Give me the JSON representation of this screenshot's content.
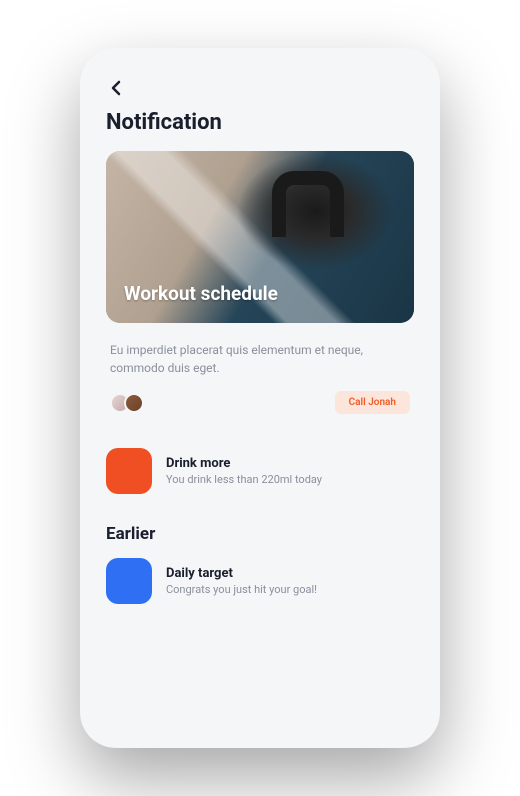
{
  "page": {
    "title": "Notification"
  },
  "workout_card": {
    "title": "Workout schedule",
    "description": "Eu imperdiet placerat quis elementum et neque, commodo duis eget.",
    "call_button_label": "Call Jonah"
  },
  "notifications": {
    "current": [
      {
        "title": "Drink more",
        "text": "You drink less than 220ml today",
        "color": "#f04e23"
      }
    ],
    "earlier_label": "Earlier",
    "earlier": [
      {
        "title": "Daily target",
        "text": "Congrats you just hit your goal!",
        "color": "#2e6ff4"
      }
    ]
  }
}
